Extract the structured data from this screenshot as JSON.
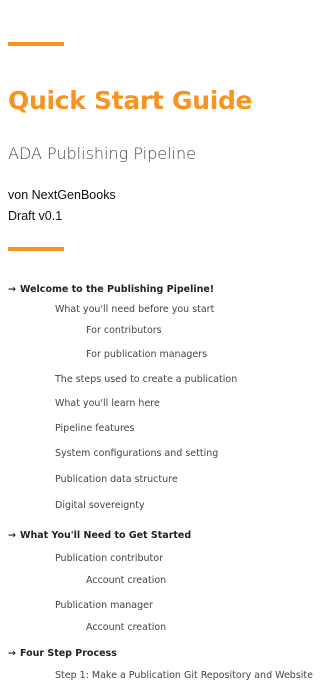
{
  "header": {
    "title": "Quick Start Guide",
    "subtitle": "ADA Publishing Pipeline",
    "author": "von NextGenBooks",
    "version": "Draft v0.1",
    "accent_color": "#f7931e"
  },
  "toc": {
    "arrow_icon": "→",
    "items": [
      {
        "label": "Welcome to the Publishing Pipeline!",
        "level": 1
      },
      {
        "label": "What you'll need before you start",
        "level": 2
      },
      {
        "label": "For contributors",
        "level": 3
      },
      {
        "label": "For publication managers",
        "level": 3
      },
      {
        "label": "The steps used to create a publication",
        "level": 2
      },
      {
        "label": "What you'll learn here",
        "level": 2
      },
      {
        "label": "Pipeline features",
        "level": 2
      },
      {
        "label": "System configurations and setting",
        "level": 2
      },
      {
        "label": "Publication data structure",
        "level": 2
      },
      {
        "label": "Digital sovereignty",
        "level": 2
      },
      {
        "label": "What You'll Need to Get Started",
        "level": 1
      },
      {
        "label": "Publication contributor",
        "level": 2
      },
      {
        "label": "Account creation",
        "level": 3
      },
      {
        "label": "Publication manager",
        "level": 2
      },
      {
        "label": "Account creation",
        "level": 3
      },
      {
        "label": "Four Step Process",
        "level": 1
      },
      {
        "label": "Step 1: Make a Publication Git Repository and Website",
        "level": 2
      }
    ]
  }
}
